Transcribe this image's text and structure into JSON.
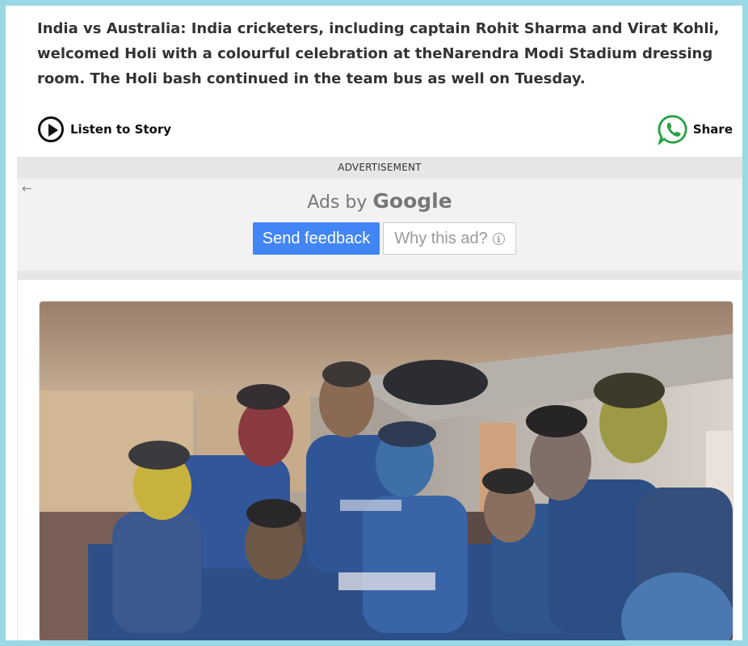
{
  "article": {
    "lead": "India vs Australia: India cricketers, including captain Rohit Sharma and Virat Kohli, welcomed Holi with a colourful celebration at theNarendra Modi Stadium dressing room. The Holi bash continued in the team bus as well on Tuesday."
  },
  "actions": {
    "listen_label": "Listen to Story",
    "share_label": "Share",
    "listen_icon": "play-circle-icon",
    "share_icon": "whatsapp-icon"
  },
  "ad": {
    "header": "ADVERTISEMENT",
    "ads_by_prefix": "Ads by",
    "ads_by_brand": "Google",
    "feedback_label": "Send feedback",
    "why_label": "Why this ad?",
    "back_icon": "arrow-left-icon",
    "info_icon": "info-icon",
    "colors": {
      "feedback_bg": "#4285f4",
      "zone_bg": "#f2f2f2"
    }
  },
  "photo": {
    "icon": "team-bus-holi-photo"
  },
  "colors": {
    "frame_border": "#9bd8e6",
    "whatsapp": "#25a244"
  }
}
